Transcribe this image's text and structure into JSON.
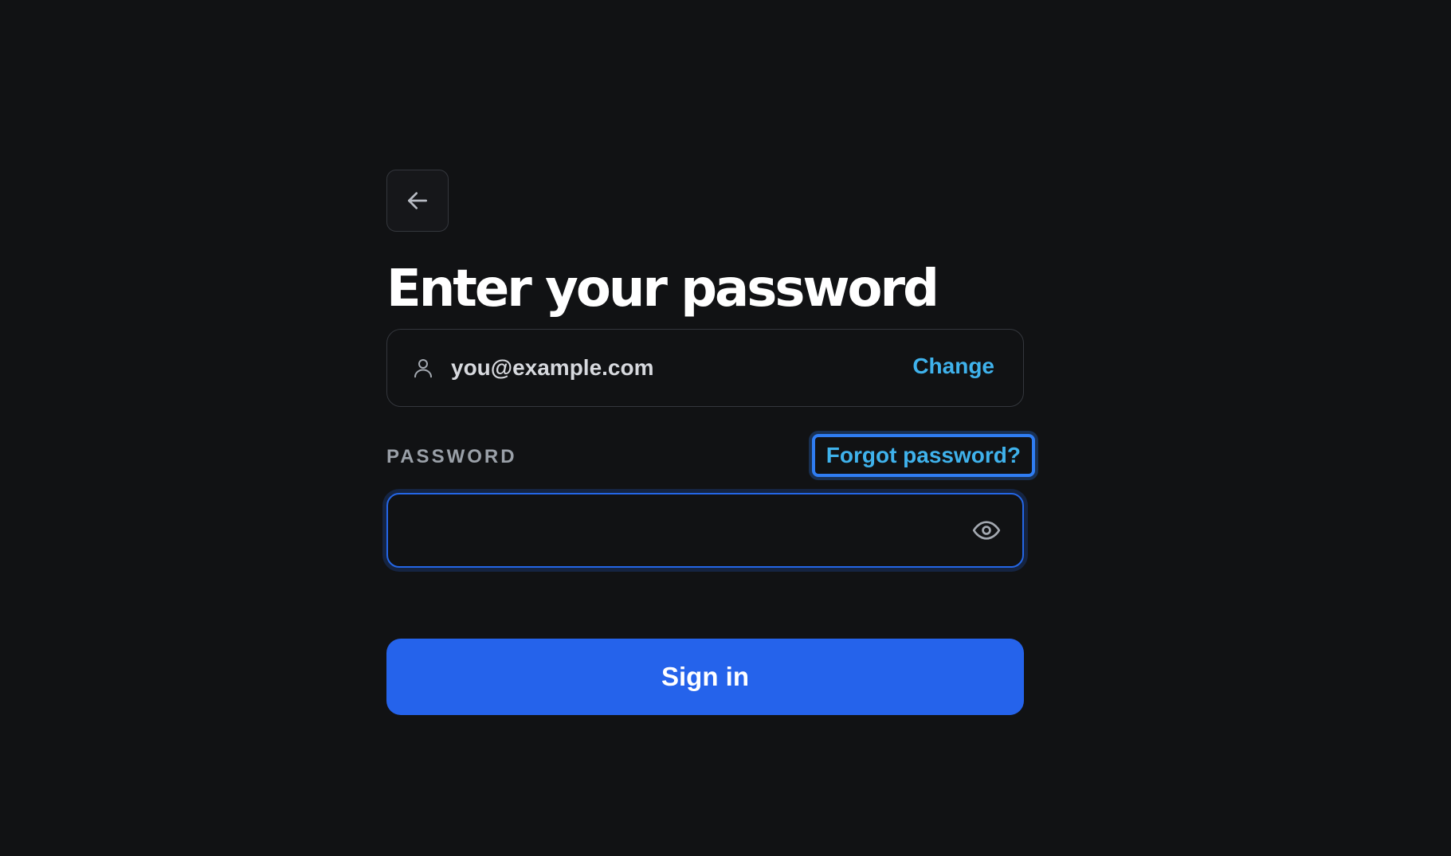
{
  "back": {
    "icon": "arrow-left-icon"
  },
  "heading": {
    "title": "Enter your password"
  },
  "identity": {
    "icon": "user-icon",
    "email": "you@example.com",
    "change_label": "Change"
  },
  "password": {
    "label": "PASSWORD",
    "forgot_label": "Forgot password?",
    "value": "",
    "toggle_icon": "eye-icon"
  },
  "submit": {
    "label": "Sign in"
  },
  "colors": {
    "background": "#111214",
    "accent": "#2563eb",
    "link": "#3fb2ec",
    "focus_ring": "#2f7df3"
  }
}
